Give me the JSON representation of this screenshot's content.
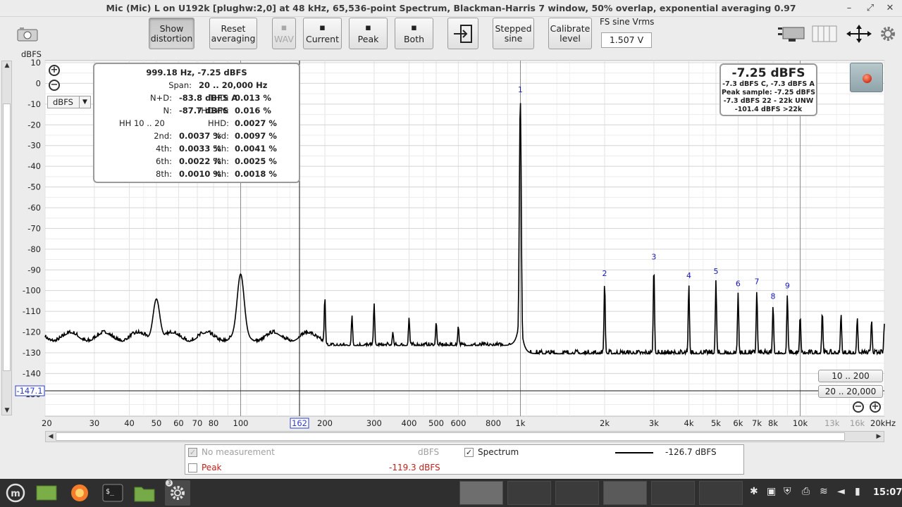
{
  "window": {
    "title": "Mic (Mic) L on U192k [plughw:2,0] at 48 kHz, 65,536-point Spectrum, Blackman-Harris 7 window, 50% overlap, exponential averaging 0.97",
    "controls": [
      "–",
      "⤢",
      "✕"
    ]
  },
  "toolbar": {
    "show_distortion": [
      "Show",
      "distortion"
    ],
    "reset_averaging": [
      "Reset",
      "averaging"
    ],
    "wav": "WAV",
    "current": "Current",
    "peak": "Peak",
    "both": "Both",
    "stepped_sine": [
      "Stepped",
      "sine"
    ],
    "calibrate_level": [
      "Calibrate",
      "level"
    ],
    "fs_label": "FS sine Vrms",
    "fs_value": "1.507 V"
  },
  "plot": {
    "y_unit_label": "dBFS",
    "units_selected": "dBFS",
    "cursor_value": "-147.1",
    "cursor_freq": "162"
  },
  "readout": {
    "header": "999.18 Hz, -7.25 dBFS",
    "span_label": "Span:",
    "span_value": "20 .. 20,000 Hz",
    "rows": [
      {
        "l1": "N+D:",
        "v1": "-83.8 dBFS A",
        "l2": "THD:",
        "v2": "0.013 %"
      },
      {
        "l1": "N:",
        "v1": "-87.7 dBFS",
        "l2": "THD+N:",
        "v2": "0.016 %"
      },
      {
        "l1": "HH 10 .. 20",
        "v1": "",
        "l2": "HHD:",
        "v2": "0.0027 %"
      },
      {
        "l1": "2nd:",
        "v1": "0.0037 %",
        "l2": "3rd:",
        "v2": "0.0097 %"
      },
      {
        "l1": "4th:",
        "v1": "0.0033 %",
        "l2": "5th:",
        "v2": "0.0041 %"
      },
      {
        "l1": "6th:",
        "v1": "0.0022 %",
        "l2": "7th:",
        "v2": "0.0025 %"
      },
      {
        "l1": "8th:",
        "v1": "0.0010 %",
        "l2": "9th:",
        "v2": "0.0018 %"
      }
    ]
  },
  "level": {
    "main": "-7.25 dBFS",
    "lines": [
      "-7.3 dBFS C, -7.3 dBFS A",
      "Peak sample: -7.25 dBFS",
      "-7.3 dBFS 22 - 22k UNW",
      "-101.4 dBFS >22k"
    ]
  },
  "ranges": {
    "low": "10 .. 200",
    "high": "20 .. 20,000"
  },
  "legend": {
    "no_measurement": "No measurement",
    "no_measurement_unit": "dBFS",
    "spectrum": "Spectrum",
    "spectrum_value": "-126.7 dBFS",
    "peak": "Peak",
    "peak_value": "-119.3 dBFS"
  },
  "taskbar": {
    "clock": "15:07",
    "badge": "3"
  },
  "chart_data": {
    "type": "line",
    "x_scale": "log",
    "xlim": [
      20,
      20000
    ],
    "ylim": [
      -155,
      10
    ],
    "xlabel": "",
    "ylabel": "dBFS",
    "x_ticks": [
      "20",
      "30",
      "40",
      "50",
      "60",
      "70",
      "80",
      "100",
      "200",
      "300",
      "400",
      "500",
      "600",
      "800",
      "1k",
      "2k",
      "3k",
      "4k",
      "5k",
      "6k",
      "7k",
      "8k",
      "10k",
      "13k",
      "16k",
      "20kHz"
    ],
    "y_ticks": [
      "10",
      "0",
      "-10",
      "-20",
      "-30",
      "-40",
      "-50",
      "-60",
      "-70",
      "-80",
      "-90",
      "-100",
      "-110",
      "-120",
      "-130",
      "-140",
      "-150"
    ],
    "series": [
      {
        "name": "Spectrum",
        "color": "#000000",
        "noise_floor": -127,
        "peaks": [
          {
            "x": 50,
            "y": -104
          },
          {
            "x": 100,
            "y": -92
          },
          {
            "x": 200,
            "y": -103
          },
          {
            "x": 250,
            "y": -112
          },
          {
            "x": 300,
            "y": -106
          },
          {
            "x": 350,
            "y": -120
          },
          {
            "x": 400,
            "y": -113
          },
          {
            "x": 500,
            "y": -115
          },
          {
            "x": 600,
            "y": -117
          },
          {
            "x": 999.18,
            "y": -7.25
          },
          {
            "x": 2000,
            "y": -96
          },
          {
            "x": 3000,
            "y": -88
          },
          {
            "x": 4000,
            "y": -97
          },
          {
            "x": 5000,
            "y": -95
          },
          {
            "x": 6000,
            "y": -101
          },
          {
            "x": 7000,
            "y": -100
          },
          {
            "x": 8000,
            "y": -107
          },
          {
            "x": 9000,
            "y": -102
          },
          {
            "x": 10000,
            "y": -112
          },
          {
            "x": 12000,
            "y": -110
          },
          {
            "x": 14000,
            "y": -111
          },
          {
            "x": 16000,
            "y": -113
          },
          {
            "x": 18000,
            "y": -114
          },
          {
            "x": 20000,
            "y": -116
          }
        ]
      }
    ],
    "harmonic_labels": [
      {
        "label": "1",
        "x": 999.18,
        "y": -7.25
      },
      {
        "label": "2",
        "x": 2000,
        "y": -96
      },
      {
        "label": "3",
        "x": 3000,
        "y": -88
      },
      {
        "label": "4",
        "x": 4000,
        "y": -97
      },
      {
        "label": "5",
        "x": 5000,
        "y": -95
      },
      {
        "label": "6",
        "x": 6000,
        "y": -101
      },
      {
        "label": "7",
        "x": 7000,
        "y": -100
      },
      {
        "label": "8",
        "x": 8000,
        "y": -107
      },
      {
        "label": "9",
        "x": 9000,
        "y": -102
      }
    ],
    "grid": true
  }
}
